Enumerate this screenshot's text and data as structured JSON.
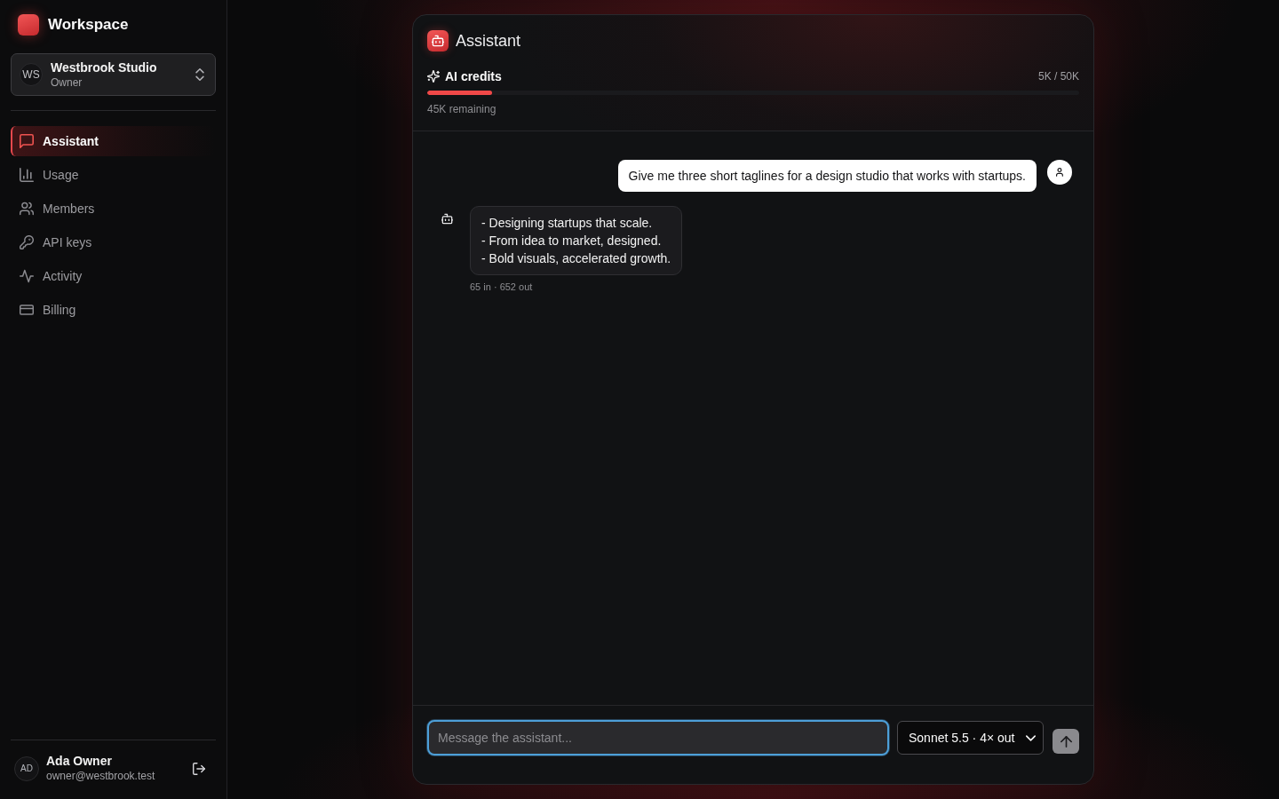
{
  "sidebar": {
    "brand": "Workspace",
    "workspace": {
      "initials": "WS",
      "name": "Westbrook Studio",
      "role": "Owner"
    },
    "nav": [
      {
        "label": "Assistant",
        "selected": true
      },
      {
        "label": "Usage",
        "selected": false
      },
      {
        "label": "Members",
        "selected": false
      },
      {
        "label": "API keys",
        "selected": false
      },
      {
        "label": "Activity",
        "selected": false
      },
      {
        "label": "Billing",
        "selected": false
      }
    ],
    "user": {
      "initials": "AD",
      "name": "Ada Owner",
      "email": "owner@westbrook.test"
    }
  },
  "assistant": {
    "title": "Assistant",
    "credits": {
      "label": "AI credits",
      "usage": "5K / 50K",
      "level": 0.1,
      "remaining": "45K remaining"
    },
    "messages": [
      {
        "kind": "user",
        "text": "Give me three short taglines for a design studio that works with startups."
      },
      {
        "kind": "assistant",
        "text": "- Designing startups that scale.\n- From idea to market, designed.\n- Bold visuals, accelerated growth.",
        "meta": "65 in · 652 out"
      }
    ],
    "composer": {
      "placeholder": "Message the assistant...",
      "focused": true,
      "model": "Sonnet 5.5 · 4× out",
      "send_disabled": true
    }
  }
}
